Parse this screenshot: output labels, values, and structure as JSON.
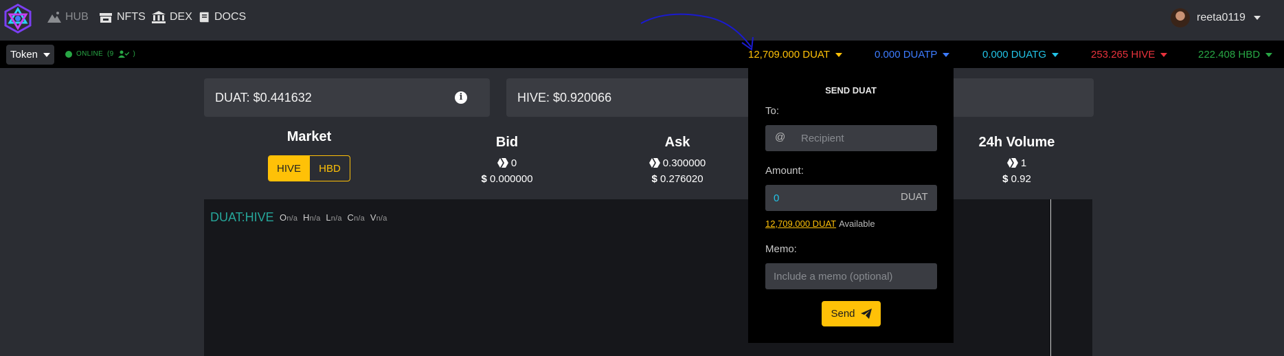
{
  "nav": {
    "items": [
      {
        "label": "HUB",
        "icon": "mountain-icon"
      },
      {
        "label": "NFTS",
        "icon": "store-icon"
      },
      {
        "label": "DEX",
        "icon": "bank-icon"
      },
      {
        "label": "DOCS",
        "icon": "book-icon"
      }
    ],
    "username": "reeta0119"
  },
  "bar": {
    "token_label": "Token",
    "online_label": "ONLINE",
    "online_count": "(9",
    "balances": {
      "duat": "12,709.000 DUAT",
      "duatp": "0.000 DUATP",
      "duatg": "0.000 DUATG",
      "hive": "253.265 HIVE",
      "hbd": "222.408 HBD"
    }
  },
  "prices": {
    "duat": "DUAT: $0.441632",
    "hive": "HIVE: $0.920066"
  },
  "stats": {
    "market_title": "Market",
    "market_options": [
      "HIVE",
      "HBD"
    ],
    "bid_title": "Bid",
    "bid_hive": "0",
    "bid_usd": "0.000000",
    "ask_title": "Ask",
    "ask_hive": "0.300000",
    "ask_usd": "0.276020",
    "volume_title": "24h Volume",
    "volume_hive": "1",
    "volume_usd": "0.92"
  },
  "chart": {
    "pair": "DUAT:HIVE",
    "ohlc": [
      {
        "k": "O",
        "v": "n/a"
      },
      {
        "k": "H",
        "v": "n/a"
      },
      {
        "k": "L",
        "v": "n/a"
      },
      {
        "k": "C",
        "v": "n/a"
      },
      {
        "k": "V",
        "v": "n/a"
      }
    ]
  },
  "send": {
    "title": "SEND DUAT",
    "to_label": "To:",
    "recipient_placeholder": "Recipient",
    "at_symbol": "@",
    "amount_label": "Amount:",
    "amount_value": "0",
    "amount_unit": "DUAT",
    "available_amount": "12,709.000 DUAT",
    "available_label": "Available",
    "memo_label": "Memo:",
    "memo_placeholder": "Include a memo (optional)",
    "send_label": "Send"
  },
  "colors": {
    "accent": "#ffc107",
    "duatp": "#3d7cff",
    "duatg": "#22c3e6",
    "hive": "#e8323c",
    "hbd": "#28a745",
    "online": "#28a745",
    "chart_pair": "#26a69a",
    "annotation": "#1a1ad0"
  }
}
